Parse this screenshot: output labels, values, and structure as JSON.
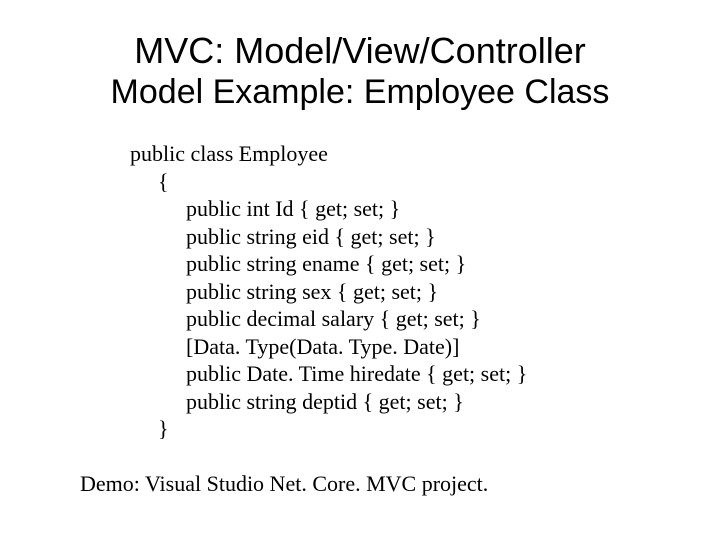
{
  "title": {
    "line1": "MVC: Model/View/Controller",
    "line2": "Model Example: Employee Class"
  },
  "code": {
    "l0": "public class Employee",
    "l1": "{",
    "l2": "public int Id { get; set; }",
    "l3": "public string eid { get; set; }",
    "l4": "public string ename { get; set; }",
    "l5": "public string sex { get; set; }",
    "l6": "public decimal salary { get; set; }",
    "l7": "[Data. Type(Data. Type. Date)]",
    "l8": "public Date. Time hiredate { get; set; }",
    "l9": "public string deptid { get; set; }",
    "l10": "}"
  },
  "footer": "Demo: Visual Studio Net. Core. MVC project."
}
